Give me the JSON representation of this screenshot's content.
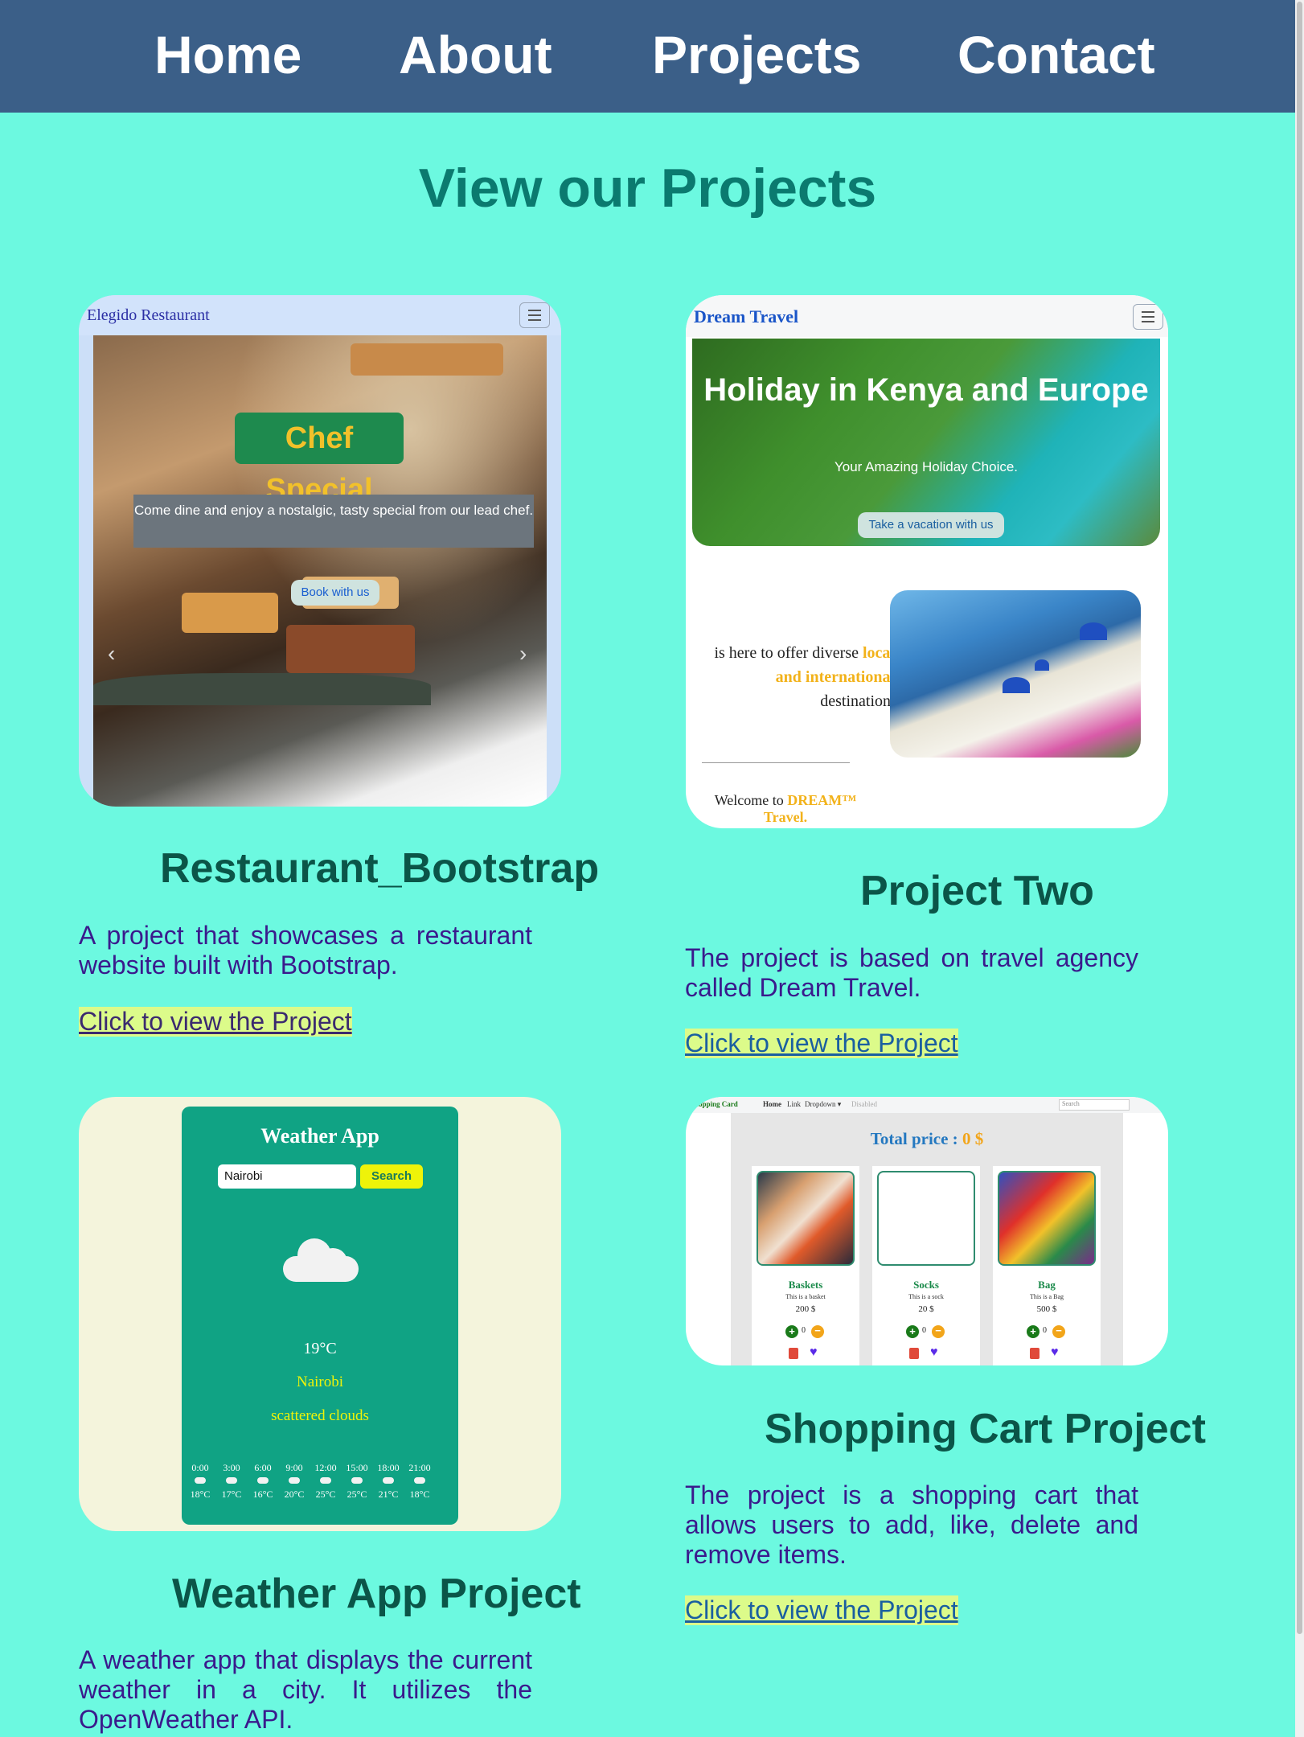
{
  "nav": {
    "items": [
      "Home",
      "About",
      "Projects",
      "Contact"
    ]
  },
  "page_title": "View our Projects",
  "projects": [
    {
      "title": "Restaurant_Bootstrap",
      "description": "A project that showcases a restaurant website built with Bootstrap.",
      "link": "Click to view the Project",
      "preview": {
        "brand": "Elegido Restaurant",
        "heading": "Chef Special",
        "caption": "Come dine and enjoy a nostalgic, tasty special from our lead chef.",
        "button": "Book with us",
        "prev_icon": "‹",
        "next_icon": "›"
      }
    },
    {
      "title": "Project Two",
      "description": "The project is based on travel agency called Dream Travel.",
      "link": "Click to view the Project",
      "preview": {
        "brand": "Dream Travel",
        "hero_title": "Holiday in Kenya and Europe",
        "hero_sub": "Your Amazing Holiday Choice.",
        "hero_button": "Take a vacation with us",
        "text_1": "is here to offer diverse",
        "text_hl": "local and international",
        "text_2": "destination.",
        "welcome_prefix": "Welcome to",
        "welcome_brand": "DREAM™ Travel."
      }
    },
    {
      "title": "Weather App Project",
      "description": "A weather app that displays the current weather in a city. It utilizes the OpenWeather API.",
      "preview": {
        "heading": "Weather App",
        "input_value": "Nairobi",
        "button": "Search",
        "temperature": "19°C",
        "city": "Nairobi",
        "condition": "scattered clouds",
        "forecast": [
          {
            "time": "0:00",
            "temp": "18°C"
          },
          {
            "time": "3:00",
            "temp": "17°C"
          },
          {
            "time": "6:00",
            "temp": "16°C"
          },
          {
            "time": "9:00",
            "temp": "20°C"
          },
          {
            "time": "12:00",
            "temp": "25°C"
          },
          {
            "time": "15:00",
            "temp": "25°C"
          },
          {
            "time": "18:00",
            "temp": "21°C"
          },
          {
            "time": "21:00",
            "temp": "18°C"
          }
        ]
      }
    },
    {
      "title": "Shopping Cart Project",
      "description": "The project is a shopping cart that allows users to add, like, delete and remove items.",
      "link": "Click to view the Project",
      "preview": {
        "brand": "Shopping Card",
        "nav_items": [
          "Home",
          "Link",
          "Dropdown ▾",
          "Disabled"
        ],
        "search_placeholder": "Search",
        "total_label": "Total price :",
        "total_value": "0 $",
        "items": [
          {
            "name": "Baskets",
            "desc": "This is a basket",
            "price": "200 $",
            "qty": "0"
          },
          {
            "name": "Socks",
            "desc": "This is a sock",
            "price": "20 $",
            "qty": "0"
          },
          {
            "name": "Bag",
            "desc": "This is a Bag",
            "price": "500 $",
            "qty": "0"
          }
        ]
      }
    }
  ],
  "colors": {
    "page_bg": "#6cf9e0",
    "nav_bg": "#3b5f88",
    "title": "#0b7a6f",
    "project_title": "#0b5548",
    "description": "#3a1a8c",
    "link_highlight": "#dcfb8a"
  }
}
